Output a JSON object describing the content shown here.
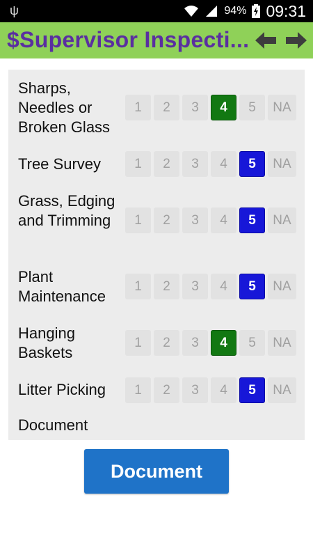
{
  "status_bar": {
    "usb_icon": "usb-icon",
    "battery": "94%",
    "time": "09:31"
  },
  "toolbar": {
    "title": "$Supervisor Inspecti...",
    "back_icon": "arrow-left-icon",
    "forward_icon": "arrow-right-icon"
  },
  "scale": [
    "1",
    "2",
    "3",
    "4",
    "5",
    "NA"
  ],
  "items": [
    {
      "label": "Sharps, Needles or Broken Glass",
      "selected": "4",
      "color": "#127812"
    },
    {
      "label": "Tree Survey",
      "selected": "5",
      "color": "#1717d8"
    },
    {
      "label": "Grass, Edging and Trimming",
      "selected": "5",
      "color": "#1717d8"
    },
    {
      "label": "Plant Maintenance",
      "selected": "5",
      "color": "#1717d8"
    },
    {
      "label": "Hanging Baskets",
      "selected": "4",
      "color": "#127812"
    },
    {
      "label": "Litter Picking",
      "selected": "5",
      "color": "#1717d8"
    }
  ],
  "document_field_label": "Document",
  "document_button_label": "Document",
  "colors": {
    "toolbar_bg": "#8fd158",
    "title_color": "#5a2fa0",
    "selected_green": "#127812",
    "selected_blue": "#1717d8",
    "button_blue": "#1f73c8"
  }
}
